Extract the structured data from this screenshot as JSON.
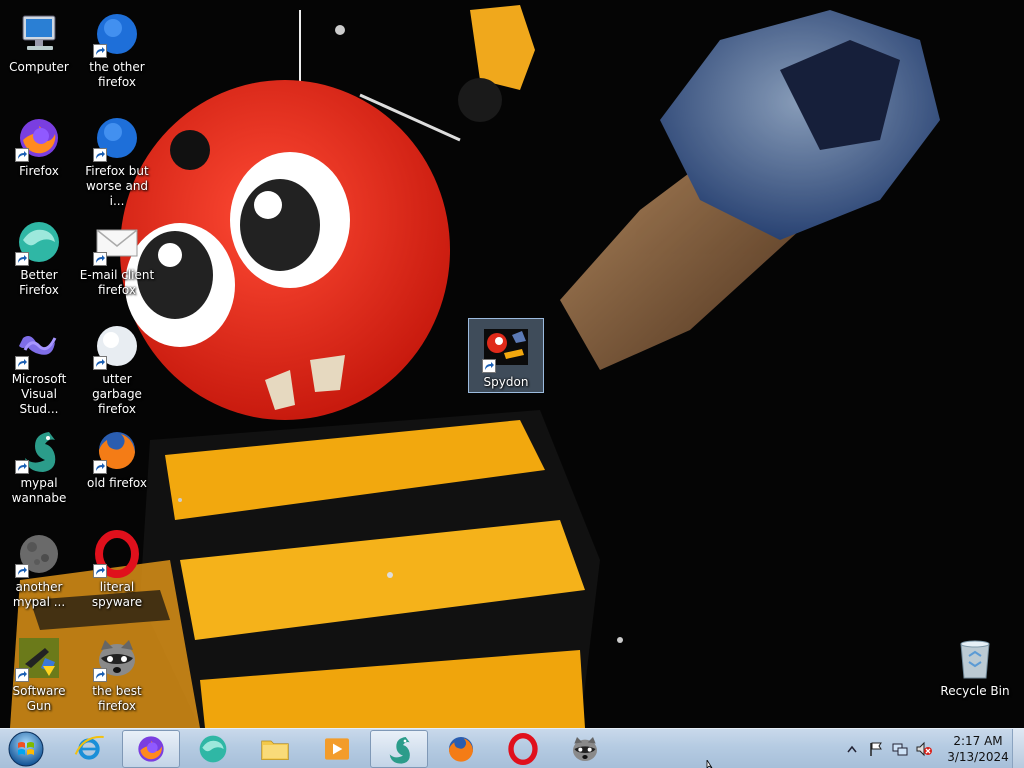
{
  "desktop": {
    "icons": [
      {
        "label": "Computer",
        "icon": "computer-icon",
        "shortcut": false
      },
      {
        "label": "the other firefox",
        "icon": "blue-globe-icon",
        "shortcut": true
      },
      {
        "label": "Firefox",
        "icon": "firefox-icon",
        "shortcut": true
      },
      {
        "label": "Firefox but worse and i...",
        "icon": "blue-globe-icon",
        "shortcut": true
      },
      {
        "label": "Better Firefox",
        "icon": "teal-globe-icon",
        "shortcut": true
      },
      {
        "label": "E-mail client firefox",
        "icon": "envelope-icon",
        "shortcut": true
      },
      {
        "label": "Microsoft Visual Stud...",
        "icon": "visual-studio-icon",
        "shortcut": true
      },
      {
        "label": "utter garbage firefox",
        "icon": "white-globe-icon",
        "shortcut": true
      },
      {
        "label": "mypal wannabe",
        "icon": "dragon-icon",
        "shortcut": true
      },
      {
        "label": "old firefox",
        "icon": "old-firefox-icon",
        "shortcut": true
      },
      {
        "label": "another mypal ...",
        "icon": "moon-icon",
        "shortcut": true
      },
      {
        "label": "literal spyware",
        "icon": "opera-icon",
        "shortcut": true
      },
      {
        "label": "Software Gun",
        "icon": "software-gun-icon",
        "shortcut": true
      },
      {
        "label": "the best firefox",
        "icon": "raccoon-icon",
        "shortcut": true
      },
      {
        "label": "Spydon",
        "icon": "spydon-icon",
        "shortcut": true,
        "selected": true
      },
      {
        "label": "Recycle Bin",
        "icon": "recycle-bin-icon",
        "shortcut": false
      }
    ]
  },
  "taskbar": {
    "pinned": [
      {
        "name": "internet-explorer",
        "icon": "internet-explorer-icon"
      },
      {
        "name": "firefox",
        "icon": "firefox-icon",
        "active": true
      },
      {
        "name": "better-firefox",
        "icon": "teal-globe-icon"
      },
      {
        "name": "file-explorer",
        "icon": "folder-icon"
      },
      {
        "name": "media-player",
        "icon": "media-player-icon"
      },
      {
        "name": "mypal",
        "icon": "dragon-icon",
        "active": true
      },
      {
        "name": "old-firefox",
        "icon": "old-firefox-icon"
      },
      {
        "name": "opera",
        "icon": "opera-icon"
      },
      {
        "name": "raccoon",
        "icon": "raccoon-icon"
      }
    ],
    "tray": {
      "icons": [
        "show-hidden-icons-icon",
        "action-center-flag-icon",
        "network-icon",
        "volume-muted-icon"
      ],
      "time": "2:17 AM",
      "date": "3/13/2024"
    }
  }
}
